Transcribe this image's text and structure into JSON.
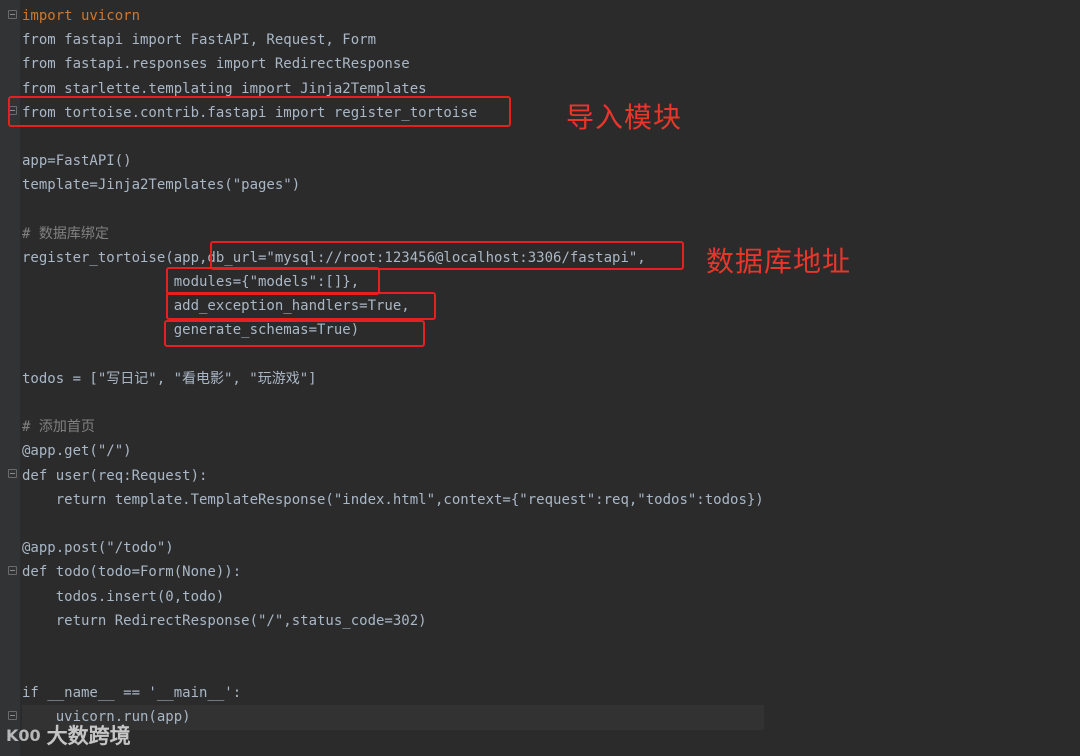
{
  "code_lines": [
    [
      "import uvicorn"
    ],
    [
      "from fastapi import FastAPI, Request, Form"
    ],
    [
      "from fastapi.responses import RedirectResponse"
    ],
    [
      "from starlette.templating import Jinja2Templates"
    ],
    [
      "from tortoise.contrib.fastapi import register_tortoise"
    ],
    [
      ""
    ],
    [
      "app=FastAPI()"
    ],
    [
      "template=Jinja2Templates(\"pages\")"
    ],
    [
      ""
    ],
    [
      "# 数据库绑定"
    ],
    [
      "register_tortoise(app,db_url=\"mysql://root:123456@localhost:3306/fastapi\","
    ],
    [
      "                  modules={\"models\":[]},"
    ],
    [
      "                  add_exception_handlers=True,"
    ],
    [
      "                  generate_schemas=True)"
    ],
    [
      ""
    ],
    [
      "todos = [\"写日记\", \"看电影\", \"玩游戏\"]"
    ],
    [
      ""
    ],
    [
      "# 添加首页"
    ],
    [
      "@app.get(\"/\")"
    ],
    [
      "def user(req:Request):"
    ],
    [
      "    return template.TemplateResponse(\"index.html\",context={\"request\":req,\"todos\":todos})"
    ],
    [
      ""
    ],
    [
      "@app.post(\"/todo\")"
    ],
    [
      "def todo(todo=Form(None)):"
    ],
    [
      "    todos.insert(0,todo)"
    ],
    [
      "    return RedirectResponse(\"/\",status_code=302)"
    ],
    [
      ""
    ],
    [
      ""
    ],
    [
      "if __name__ == '__main__':"
    ],
    [
      "    uvicorn.run(app)"
    ]
  ],
  "annotations": {
    "import_module": "导入模块",
    "db_address": "数据库地址"
  },
  "watermark": {
    "logo": "K00",
    "text": "大数跨境"
  },
  "colors": {
    "background": "#2b2b2b",
    "keyword": "#cc7832",
    "string": "#6a8759",
    "number": "#6897bb",
    "parameter": "#aa4926",
    "comment": "#808080",
    "function": "#ffc66d",
    "decorator": "#bbb529",
    "highlight_box": "#e62020",
    "annotation_text": "#e8362a"
  }
}
